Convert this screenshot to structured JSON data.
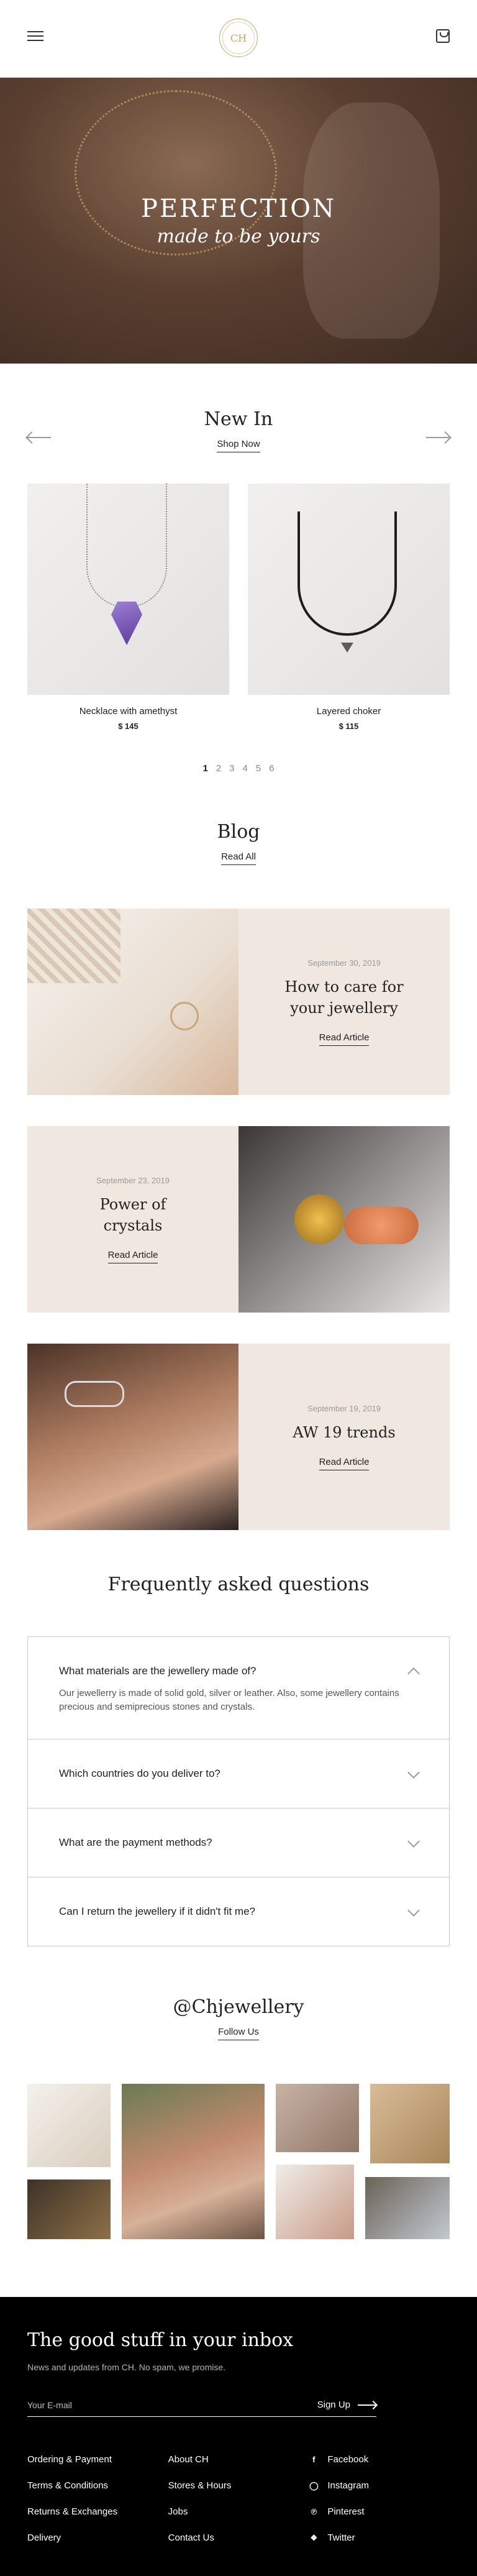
{
  "header": {
    "logo_text": "CH",
    "menu_icon": "hamburger-menu-icon",
    "cart_icon": "shopping-bag-icon"
  },
  "hero": {
    "title": "PERFECTION",
    "subtitle": "made to be yours"
  },
  "new_in": {
    "title": "New In",
    "link": "Shop Now",
    "products": [
      {
        "name": "Necklace with amethyst",
        "price": "$ 145"
      },
      {
        "name": "Layered choker",
        "price": "$ 115"
      }
    ],
    "pages": [
      "1",
      "2",
      "3",
      "4",
      "5",
      "6"
    ],
    "active_page": "1"
  },
  "blog": {
    "title": "Blog",
    "link": "Read All",
    "posts": [
      {
        "date": "September 30, 2019",
        "title": "How to care for your jewellery",
        "link": "Read Article"
      },
      {
        "date": "September 23, 2019",
        "title": "Power of crystals",
        "link": "Read Article"
      },
      {
        "date": "September 19, 2019",
        "title": "AW 19 trends",
        "link": "Read Article"
      }
    ]
  },
  "faq": {
    "title": "Frequently asked questions",
    "items": [
      {
        "q": "What materials are the jewellery made of?",
        "a": "Our jewellerry is made of solid gold, silver or leather.  Also, some jewellery contains precious and semiprecious stones and crystals.",
        "open": true
      },
      {
        "q": "Which countries do you deliver to?",
        "a": "",
        "open": false
      },
      {
        "q": "What are the payment methods?",
        "a": "",
        "open": false
      },
      {
        "q": "Can I return the jewellery if it didn't fit me?",
        "a": "",
        "open": false
      }
    ]
  },
  "instagram": {
    "title": "@Chjewellery",
    "link": "Follow Us"
  },
  "footer": {
    "title": "The good stuff in your inbox",
    "subtitle": "News and updates from CH. No spam, we promise.",
    "email_placeholder": "Your E-mail",
    "signup": "Sign Up",
    "col1": [
      "Ordering & Payment",
      "Terms & Conditions",
      "Returns & Exchanges",
      "Delivery"
    ],
    "col2": [
      "About CH",
      "Stores & Hours",
      "Jobs",
      "Contact Us"
    ],
    "social": [
      "Facebook",
      "Instagram",
      "Pinterest",
      "Twitter"
    ]
  },
  "colors": {
    "accent_gold": "#c9a66b",
    "blog_card_bg": "#f0e7e1",
    "footer_bg": "#000000"
  }
}
